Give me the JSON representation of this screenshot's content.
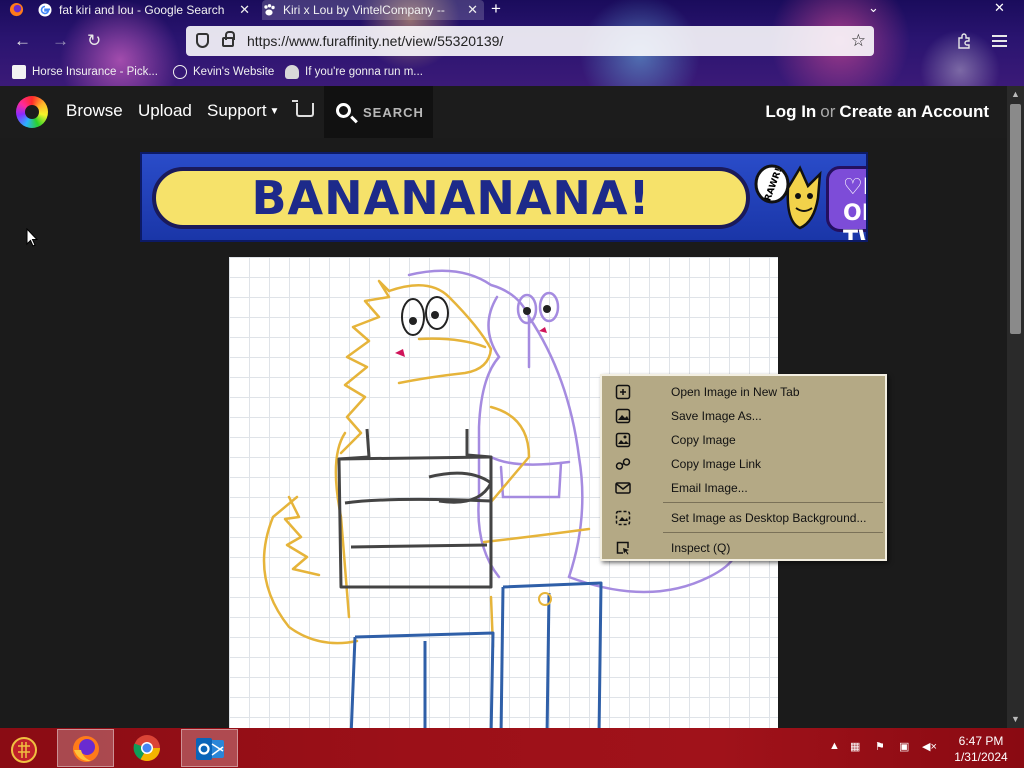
{
  "browser": {
    "tabs": [
      {
        "title": "fat kiri and lou - Google Search",
        "favicon": "google-icon",
        "active": false
      },
      {
        "title": "Kiri x Lou by VintelCompany -- Fur Affinity",
        "favicon": "paw-icon",
        "active": true
      }
    ],
    "new_tab": "+",
    "url": "https://www.furaffinity.net/view/55320139/",
    "bookmarks": [
      {
        "label": "Horse Insurance - Pick...",
        "icon": "page-icon"
      },
      {
        "label": "Kevin's Website",
        "icon": "globe-icon"
      },
      {
        "label": "If you're gonna run m...",
        "icon": "badge-icon"
      }
    ]
  },
  "site": {
    "nav": {
      "browse": "Browse",
      "upload": "Upload",
      "support": "Support",
      "search": "SEARCH",
      "login": "Log In",
      "or": "or",
      "create": "Create an Account"
    },
    "banner": {
      "headline": "BANANANANA!",
      "bubble": "RAWR!",
      "follow_line1": "♡FOLLOW",
      "follow_line2": "ON TWITCH!"
    }
  },
  "context_menu": {
    "items": [
      {
        "label": "Open Image in New Tab",
        "icon": "open-new-tab-icon"
      },
      {
        "label": "Save Image As...",
        "icon": "save-image-icon"
      },
      {
        "label": "Copy Image",
        "icon": "copy-image-icon"
      },
      {
        "label": "Copy Image Link",
        "icon": "link-icon"
      },
      {
        "label": "Email Image...",
        "icon": "email-icon"
      },
      {
        "label": "Set Image as Desktop Background...",
        "icon": "desktop-background-icon"
      },
      {
        "label": "Inspect (Q)",
        "icon": "inspect-icon"
      }
    ]
  },
  "taskbar": {
    "apps": [
      "firefox-icon",
      "chrome-icon",
      "outlook-icon"
    ],
    "time": "6:47 PM",
    "date": "1/31/2024"
  },
  "colors": {
    "menu_bg": "#b4a985",
    "taskbar": "#9c1018",
    "site_bg": "#1b1b1b"
  }
}
